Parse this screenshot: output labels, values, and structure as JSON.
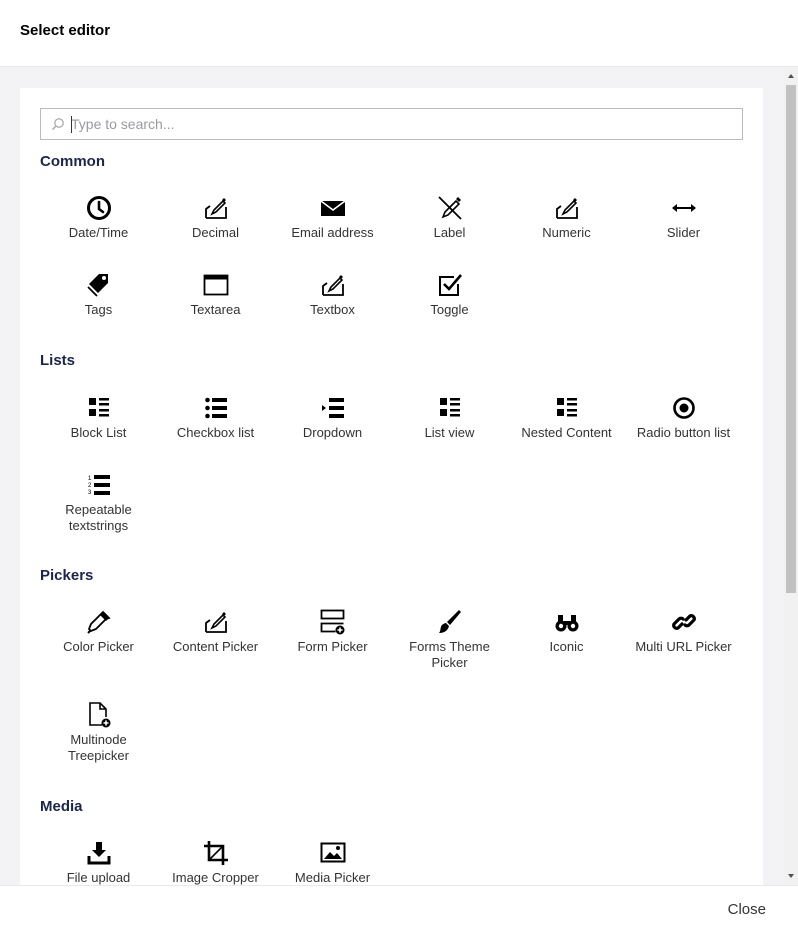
{
  "dialog": {
    "title": "Select editor",
    "close_label": "Close"
  },
  "search": {
    "placeholder": "Type to search..."
  },
  "sections": {
    "common": {
      "title": "Common",
      "items": [
        {
          "label": "Date/Time",
          "icon": "clock-icon"
        },
        {
          "label": "Decimal",
          "icon": "edit-icon"
        },
        {
          "label": "Email address",
          "icon": "envelope-icon"
        },
        {
          "label": "Label",
          "icon": "pen-crossed-icon"
        },
        {
          "label": "Numeric",
          "icon": "edit-icon"
        },
        {
          "label": "Slider",
          "icon": "horizontal-arrows-icon"
        },
        {
          "label": "Tags",
          "icon": "tags-icon"
        },
        {
          "label": "Textarea",
          "icon": "window-icon"
        },
        {
          "label": "Textbox",
          "icon": "edit-icon"
        },
        {
          "label": "Toggle",
          "icon": "checkbox-icon"
        }
      ]
    },
    "lists": {
      "title": "Lists",
      "items": [
        {
          "label": "Block List",
          "icon": "block-list-icon"
        },
        {
          "label": "Checkbox list",
          "icon": "bullet-list-icon"
        },
        {
          "label": "Dropdown",
          "icon": "dropdown-list-icon"
        },
        {
          "label": "List view",
          "icon": "block-list-icon"
        },
        {
          "label": "Nested Content",
          "icon": "block-list-icon"
        },
        {
          "label": "Radio button list",
          "icon": "radio-button-icon"
        },
        {
          "label": "Repeatable textstrings",
          "icon": "numbered-list-icon"
        }
      ]
    },
    "pickers": {
      "title": "Pickers",
      "items": [
        {
          "label": "Color Picker",
          "icon": "eyedropper-icon"
        },
        {
          "label": "Content Picker",
          "icon": "edit-icon"
        },
        {
          "label": "Form Picker",
          "icon": "form-add-icon"
        },
        {
          "label": "Forms Theme Picker",
          "icon": "brush-icon"
        },
        {
          "label": "Iconic",
          "icon": "binoculars-icon"
        },
        {
          "label": "Multi URL Picker",
          "icon": "link-icon"
        },
        {
          "label": "Multinode Treepicker",
          "icon": "document-add-icon"
        }
      ]
    },
    "media": {
      "title": "Media",
      "items": [
        {
          "label": "File upload",
          "icon": "download-tray-icon"
        },
        {
          "label": "Image Cropper",
          "icon": "crop-icon"
        },
        {
          "label": "Media Picker",
          "icon": "picture-icon"
        }
      ]
    }
  }
}
